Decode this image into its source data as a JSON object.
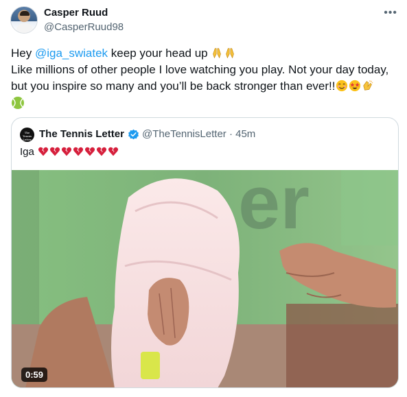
{
  "author": {
    "name": "Casper Ruud",
    "handle": "@CasperRuud98"
  },
  "more_icon": "more-dots-icon",
  "tweet": {
    "greeting": "Hey ",
    "mention": "@iga_swiatek",
    "line1_rest": " keep your head up",
    "line2": "Like millions of other people I love watching you play. Not your day today,",
    "line3": "but you inspire so many and you’ll be back stronger than ever!!",
    "emojis": [
      "folded-hands-icon",
      "folded-hands-icon",
      "smiling-face-icon",
      "star-struck-icon",
      "clapping-hands-icon",
      "tennis-ball-icon"
    ]
  },
  "quoted": {
    "avatar_text": "The Tennis Letter",
    "name": "The Tennis Letter",
    "handle_time": "@TheTennisLetter · 45m",
    "text": "Iga",
    "broken_hearts": 7,
    "video_duration": "0:59"
  },
  "colors": {
    "link": "#1d9bf0",
    "verified": "#1d9bf0",
    "secondary_text": "#536471",
    "border": "#cfd9de",
    "broken_heart": "#d61f3c"
  }
}
